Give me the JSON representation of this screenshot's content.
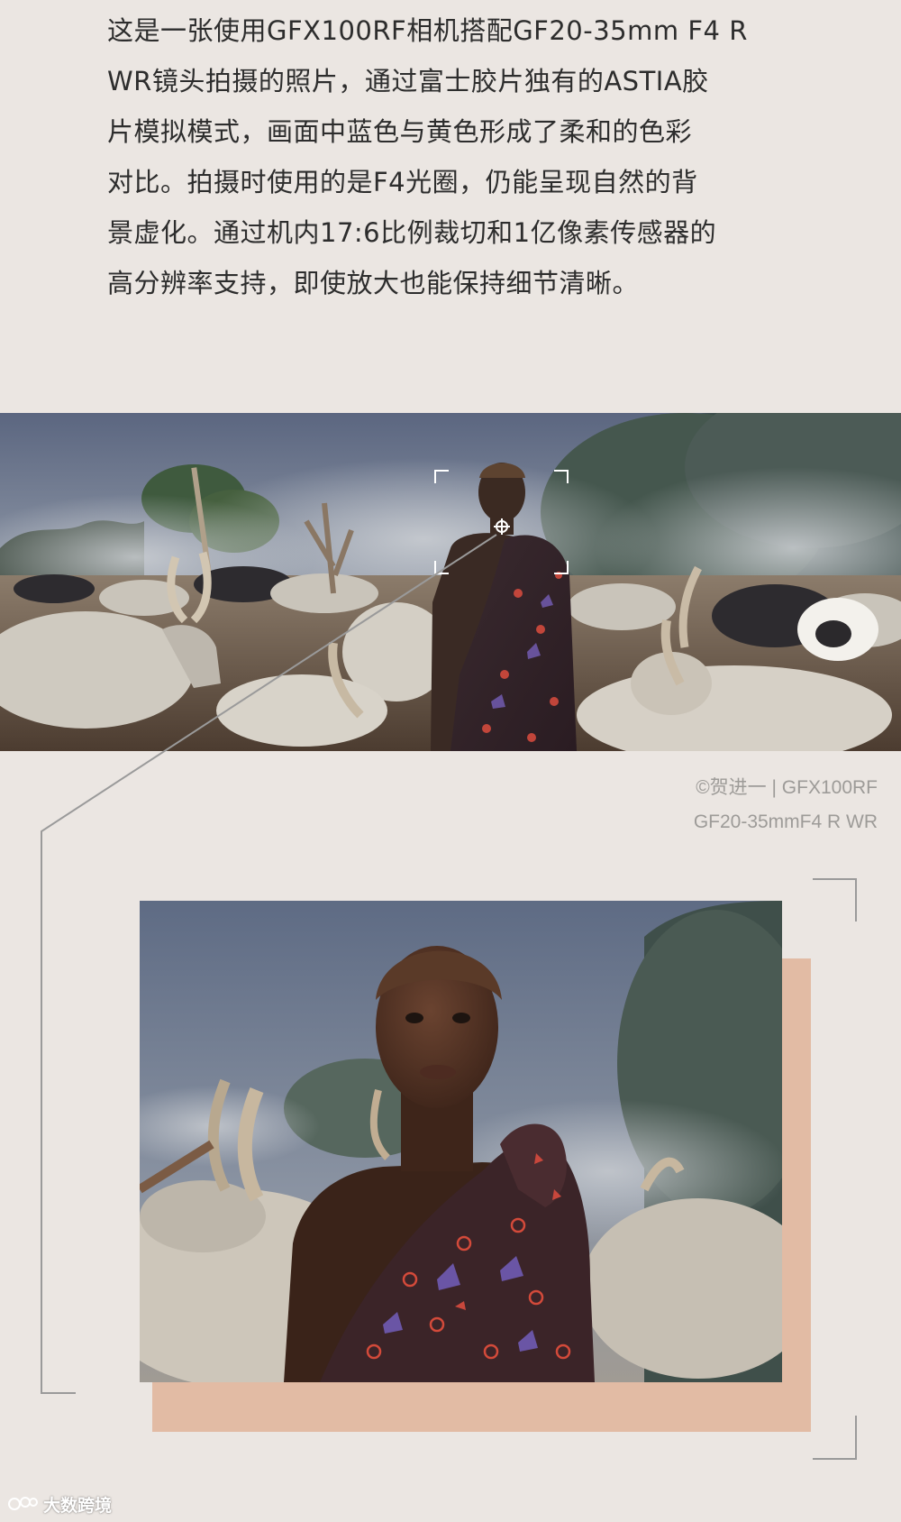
{
  "intro": {
    "lines": [
      "这是一张使用GFX100RF相机搭配GF20-35mm F4 R",
      "WR镜头拍摄的照片，通过富士胶片独有的ASTIA胶",
      "片模拟模式，画面中蓝色与黄色形成了柔和的色彩",
      "对比。拍摄时使用的是F4光圈，仍能呈现自然的背",
      "景虚化。通过机内17:6比例裁切和1亿像素传感器的",
      "高分辨率支持，即使放大也能保持细节清晰。"
    ]
  },
  "credit": {
    "line1": "©贺进一 | GFX100RF",
    "line2": "GF20-35mmF4 R WR"
  },
  "watermark": {
    "text": "大数跨境"
  },
  "colors": {
    "background": "#ebe6e2",
    "accent_peach": "#e2bba4",
    "frame_line": "#9a9a9a",
    "text": "#2d2d2d",
    "caption": "#9d9b98"
  }
}
